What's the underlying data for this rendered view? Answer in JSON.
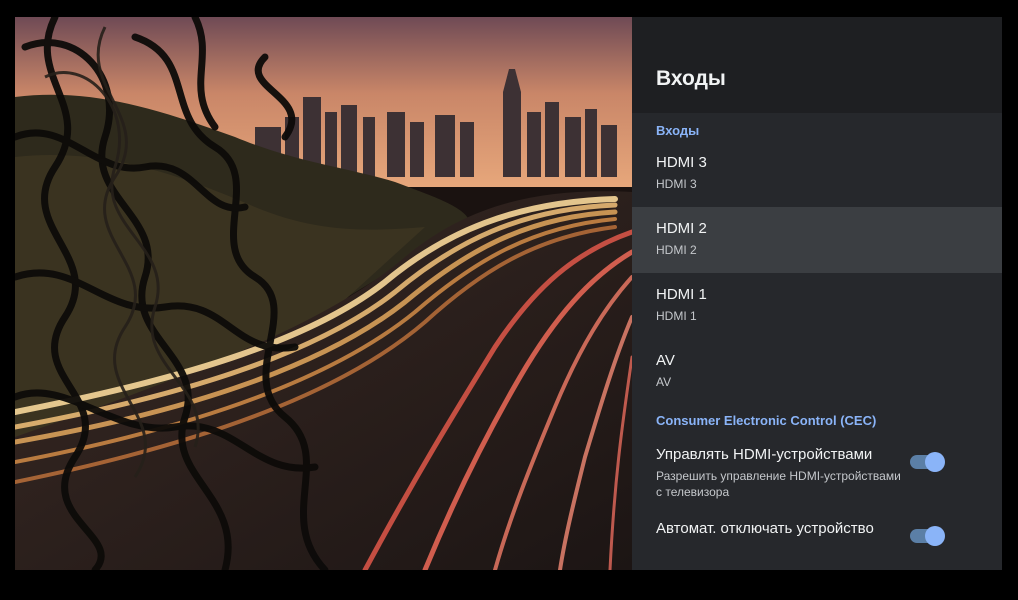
{
  "panel": {
    "title": "Входы",
    "inputs_section": "Входы",
    "inputs": [
      {
        "title": "HDMI 3",
        "subtitle": "HDMI 3"
      },
      {
        "title": "HDMI 2",
        "subtitle": "HDMI 2"
      },
      {
        "title": "HDMI 1",
        "subtitle": "HDMI 1"
      },
      {
        "title": "AV",
        "subtitle": "AV"
      }
    ],
    "focused_index": 1,
    "cec_section": "Consumer Electronic Control (CEC)",
    "cec_items": [
      {
        "title": "Управлять HDMI-устройствами",
        "subtitle": "Разрешить управление HDMI-устройствами с телевизора",
        "enabled": true
      },
      {
        "title": "Автомат. отключать устройство",
        "subtitle": "",
        "enabled": true
      }
    ]
  },
  "colors": {
    "panel_bg": "#26282c",
    "header_bg": "#1e1f22",
    "focus_bg": "#3b3e42",
    "accent": "#8ab4f8"
  }
}
